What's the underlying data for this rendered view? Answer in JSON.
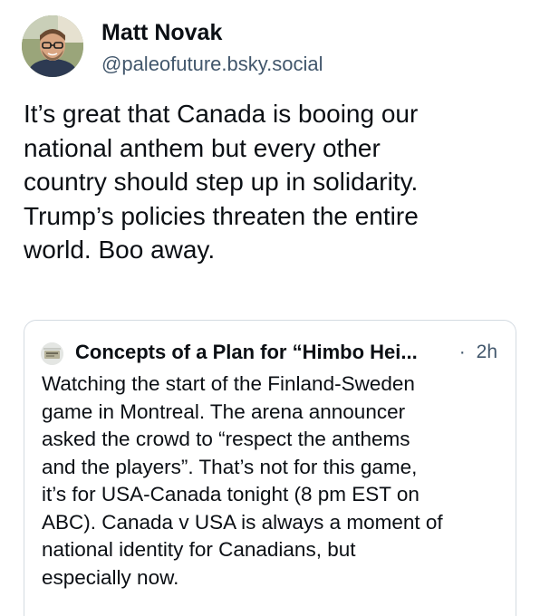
{
  "post": {
    "author": {
      "name": "Matt Novak",
      "handle": "@paleofuture.bsky.social"
    },
    "text_lines": [
      "It’s great that Canada is booing our",
      "national anthem but every other",
      "country should step up in solidarity.",
      "Trump’s policies threaten the entire",
      "world. Boo away."
    ]
  },
  "quoted_post": {
    "author_display": "Concepts of a Plan for “Himbo Hei...",
    "separator": "·",
    "time": "2h",
    "text_lines": [
      "Watching the start of the Finland-Sweden",
      "game in Montreal. The arena announcer",
      "asked the crowd to “respect the anthems",
      "and the players”. That’s not for this game,",
      "it’s for USA-Canada tonight (8 pm EST on",
      "ABC). Canada v USA is always a moment of",
      "national identity for Canadians, but",
      "especially now."
    ]
  },
  "colors": {
    "text": "#0b0f14",
    "secondary_text": "#42576c",
    "card_border": "#d4dbe2",
    "background": "#ffffff"
  },
  "icons": {
    "author_avatar": "profile-photo-avatar",
    "quoted_author_avatar": "quoted-profile-avatar"
  }
}
